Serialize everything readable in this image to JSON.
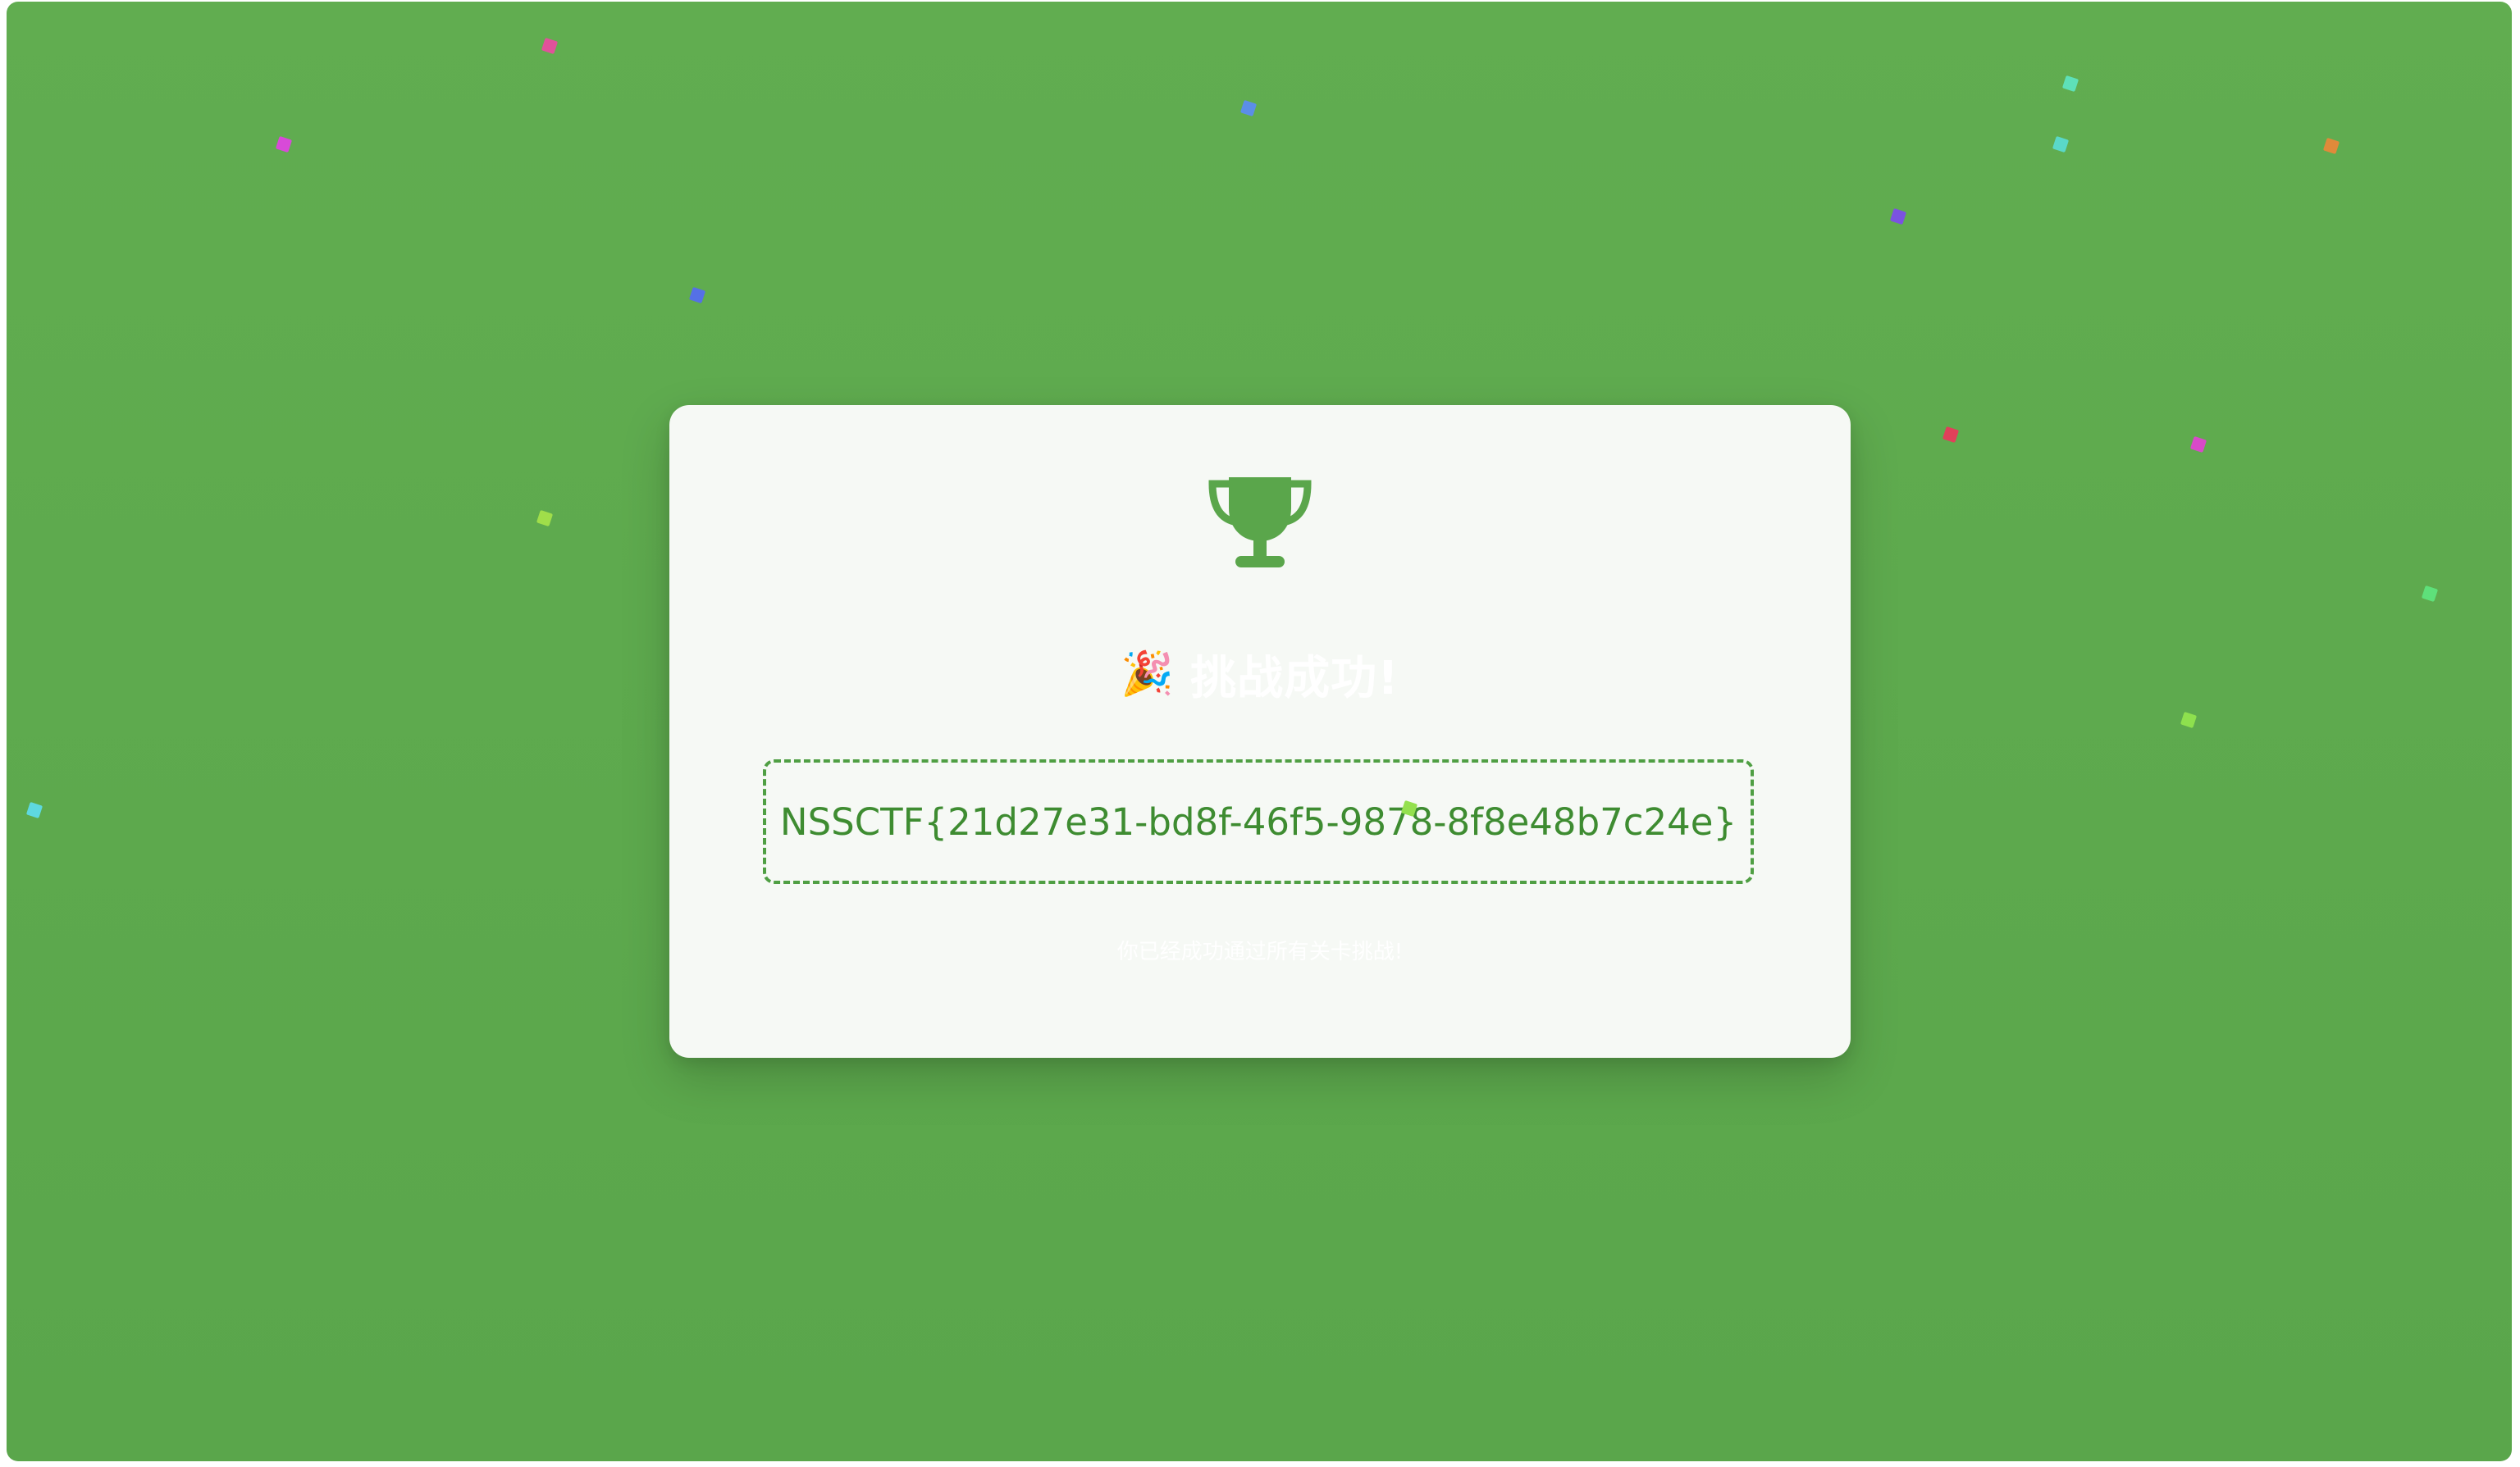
{
  "card": {
    "title": "挑战成功!",
    "flag": "NSSCTF{21d27e31-bd8f-46f5-9878-8f8e48b7c24e}",
    "subtitle": "你已经成功通过所有关卡挑战!"
  },
  "icons": {
    "trophy": "trophy-icon",
    "party": "party-popper-icon"
  },
  "colors": {
    "background": "#5ea94d",
    "card": "#f6f9f5",
    "accent": "#4f9f43",
    "flag_text": "#3e8c31"
  }
}
